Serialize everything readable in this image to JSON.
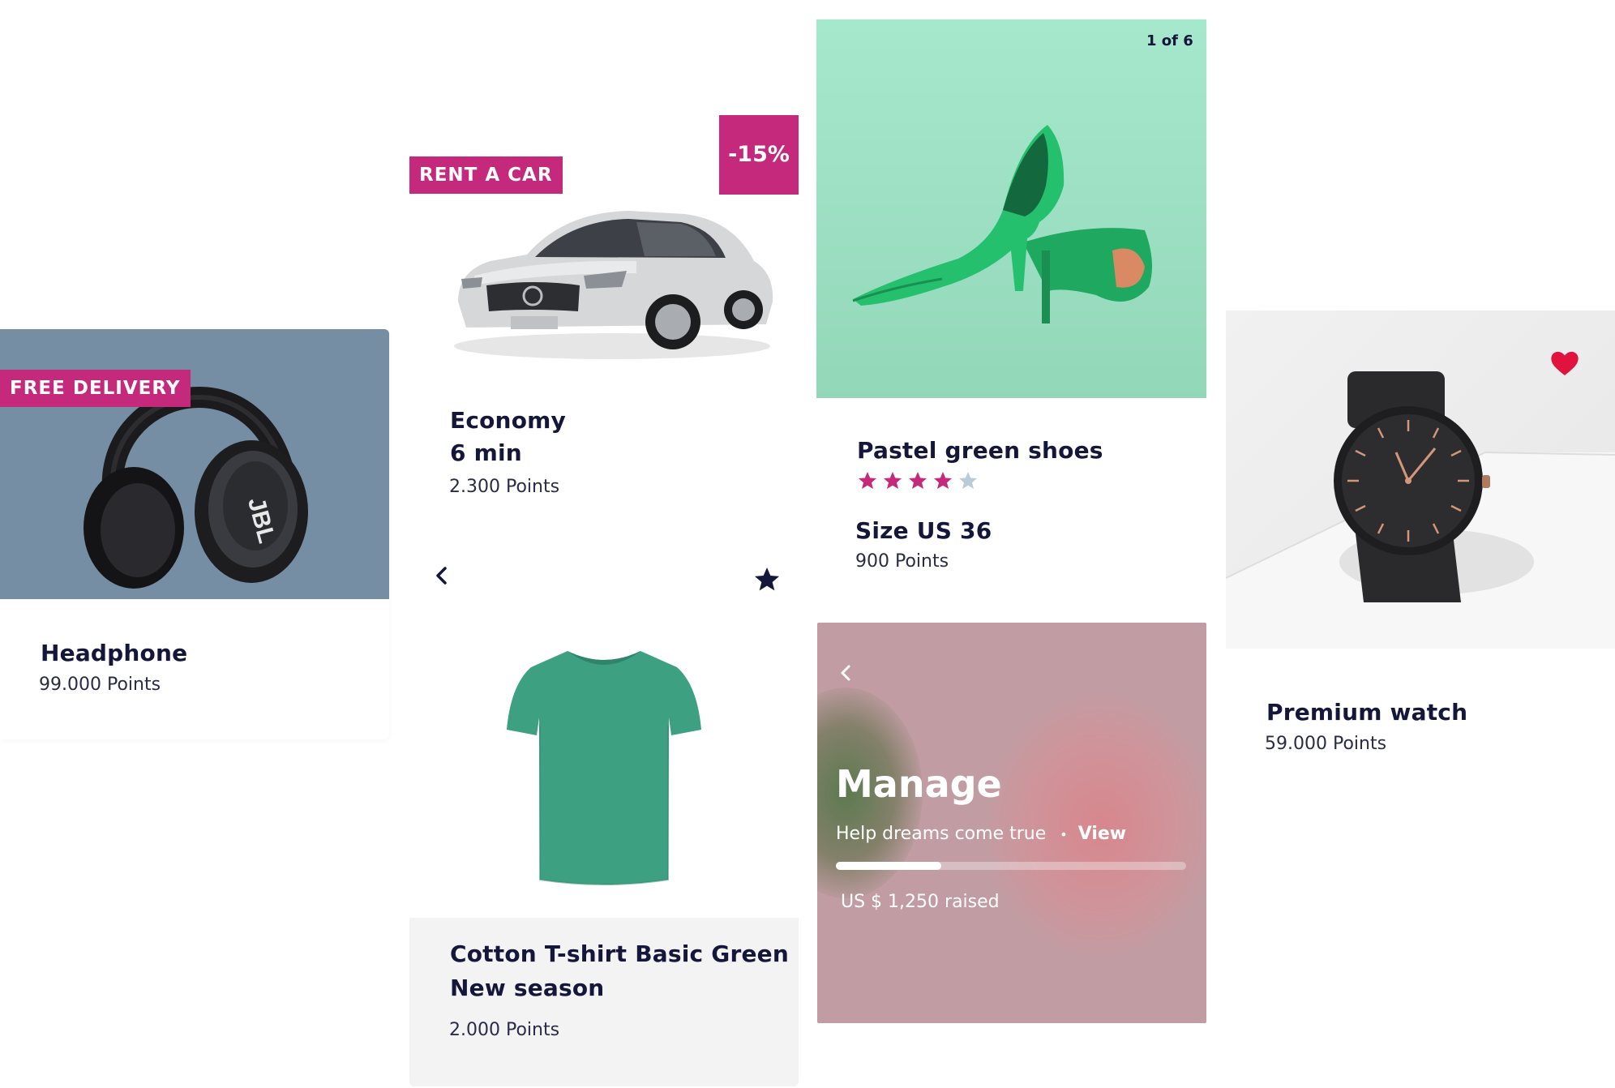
{
  "colors": {
    "accent": "#c4297b",
    "text_dark": "#14163a",
    "star_empty": "#b8cbd9",
    "heart": "#e0133f",
    "headphone_bg": "#758ea3",
    "shoes_bg": "#a3e6c9",
    "manage_bg": "#c19da3",
    "tshirt_footer": "#f3f3f4"
  },
  "headphone_card": {
    "badge": "FREE DELIVERY",
    "title": "Headphone",
    "points": "99.000 Points",
    "brand": "JBL",
    "image_icon": "headphones-icon"
  },
  "car_card": {
    "badge": "RENT A CAR",
    "discount": "-15%",
    "title_line1": "Economy",
    "title_line2": "6 min",
    "points": "2.300 Points",
    "image_icon": "car-icon"
  },
  "tshirt_card": {
    "back_icon": "chevron-left-icon",
    "favorite_icon": "star-icon",
    "title_line1": "Cotton T-shirt Basic Green",
    "title_line2": "New season",
    "points": "2.000 Points",
    "image_icon": "tshirt-icon"
  },
  "shoes_card": {
    "pager": "1 of 6",
    "title": "Pastel green shoes",
    "rating": 4,
    "rating_max": 5,
    "size": "Size US 36",
    "points": "900 Points",
    "image_icon": "high-heel-icon"
  },
  "manage_card": {
    "back_icon": "chevron-left-icon",
    "title": "Manage",
    "subtitle": "Help dreams come true",
    "separator": "•",
    "link": "View",
    "progress": 0.3,
    "raised": "US $ 1,250 raised"
  },
  "watch_card": {
    "favorite_icon": "heart-icon",
    "title": "Premium watch",
    "points": "59.000 Points",
    "image_icon": "watch-icon"
  }
}
